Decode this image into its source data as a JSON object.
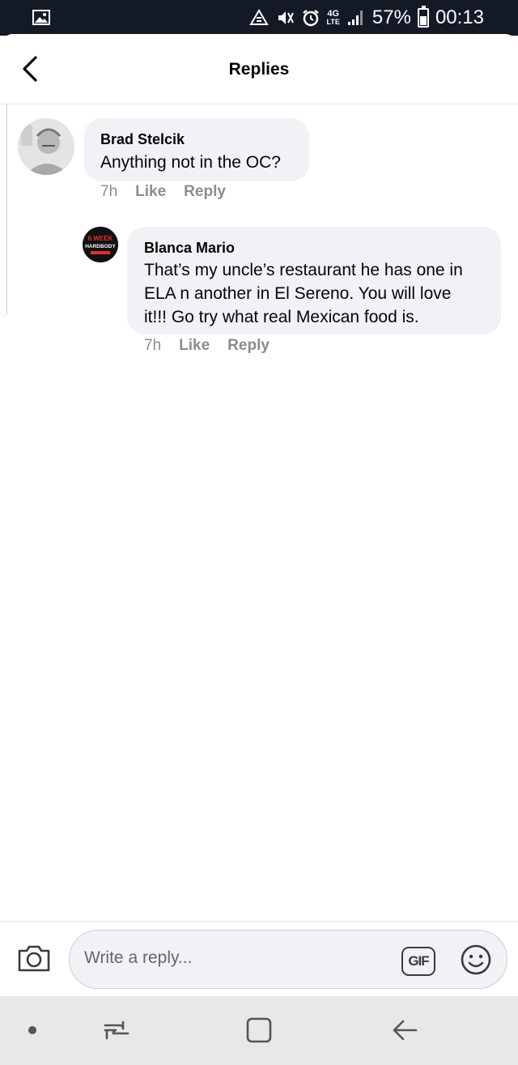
{
  "status_bar": {
    "network": "4G",
    "network_sub": "LTE",
    "battery": "57%",
    "time": "00:13",
    "icons": [
      "gallery-icon",
      "data-saver-icon",
      "mute-icon",
      "alarm-icon",
      "signal-icon",
      "battery-icon"
    ]
  },
  "header": {
    "title": "Replies",
    "back_icon": "chevron-left-icon"
  },
  "comments": [
    {
      "author": "Brad Stelcik",
      "text": "Anything not in the OC?",
      "time": "7h",
      "like_label": "Like",
      "reply_label": "Reply"
    },
    {
      "author": "Blanca Mario",
      "text_lines": [
        "That’s my uncle’s restaurant he has one in",
        "ELA n another in El Sereno. You will love",
        "it!!! Go try what real Mexican food is."
      ],
      "time": "7h",
      "like_label": "Like",
      "reply_label": "Reply",
      "avatar_text": [
        "6 WEEK",
        "HARDBODY"
      ]
    }
  ],
  "composer": {
    "placeholder": "Write a reply...",
    "gif_label": "GIF",
    "icons": [
      "camera-icon",
      "emoji-icon"
    ]
  },
  "nav_bar": {
    "icons": [
      "dot-icon",
      "recent-apps-icon",
      "home-icon",
      "back-arrow-icon"
    ]
  },
  "colors": {
    "status_bar_bg": "#131a26",
    "bubble_bg": "#f0f2f5",
    "meta_text": "#8a8d91",
    "nav_bar_bg": "#e8e8ea"
  }
}
